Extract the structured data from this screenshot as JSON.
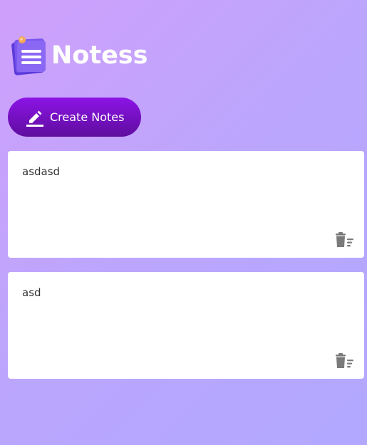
{
  "app": {
    "title": "Notess",
    "logo_icon": "notes-logo-icon"
  },
  "toolbar": {
    "create_label": "Create Notes",
    "create_icon": "pencil-icon"
  },
  "colors": {
    "accent": "#7a12c8",
    "background_start": "#cfa0fb",
    "background_end": "#b2a8ff",
    "note_bg": "#ffffff",
    "delete_icon": "#7a7a7a"
  },
  "notes": [
    {
      "text": "asdasd",
      "delete_icon": "delete-icon"
    },
    {
      "text": "asd",
      "delete_icon": "delete-icon"
    }
  ]
}
